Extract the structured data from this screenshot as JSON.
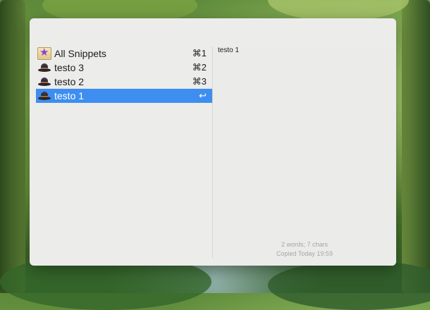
{
  "snippets_list": [
    {
      "label": "All Snippets",
      "shortcut": "⌘1",
      "icon": "all-snippets-star-icon"
    },
    {
      "label": "testo 3",
      "shortcut": "⌘2",
      "icon": "hat-icon"
    },
    {
      "label": "testo 2",
      "shortcut": "⌘3",
      "icon": "hat-icon"
    },
    {
      "label": "testo 1",
      "shortcut": "↩",
      "icon": "hat-icon"
    }
  ],
  "selected": "testo 1",
  "preview": {
    "text": "testo 1",
    "stats": "2 words; 7 chars",
    "copied": "Copied Today 19:59"
  },
  "colors": {
    "selection": "#3d8ef0",
    "window_bg": "#ececeb"
  }
}
